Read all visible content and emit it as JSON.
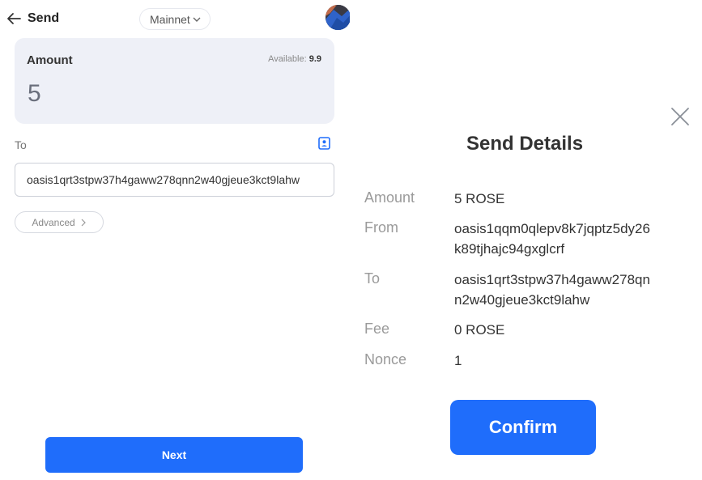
{
  "header": {
    "title": "Send",
    "network": "Mainnet",
    "back_icon": "arrow-left-icon",
    "avatar_icon": "account-avatar"
  },
  "amount": {
    "label": "Amount",
    "available_label": "Available:",
    "available_value": "9.9",
    "value": "5"
  },
  "to": {
    "label": "To",
    "value": "oasis1qrt3stpw37h4gaww278qnn2w40gjeue3kct9lahw",
    "address_book_icon": "address-book-icon"
  },
  "advanced": {
    "label": "Advanced",
    "icon": "chevron-right-icon"
  },
  "next_label": "Next",
  "details": {
    "title": "Send Details",
    "close_icon": "close-icon",
    "rows": {
      "amount": {
        "label": "Amount",
        "value": "5 ROSE"
      },
      "from": {
        "label": "From",
        "value_line1": "oasis1qqm0qlepv8k7jqptz5dy26",
        "value_line2": "k89tjhajc94gxglcrf"
      },
      "to": {
        "label": "To",
        "value_line1": "oasis1qrt3stpw37h4gaww278qn",
        "value_line2": "n2w40gjeue3kct9lahw"
      },
      "fee": {
        "label": "Fee",
        "value": "0 ROSE"
      },
      "nonce": {
        "label": "Nonce",
        "value": "1"
      }
    },
    "confirm_label": "Confirm"
  },
  "colors": {
    "accent": "#1f6dfb",
    "card_bg": "#eef0f7",
    "muted_text": "#9a9a9a"
  }
}
